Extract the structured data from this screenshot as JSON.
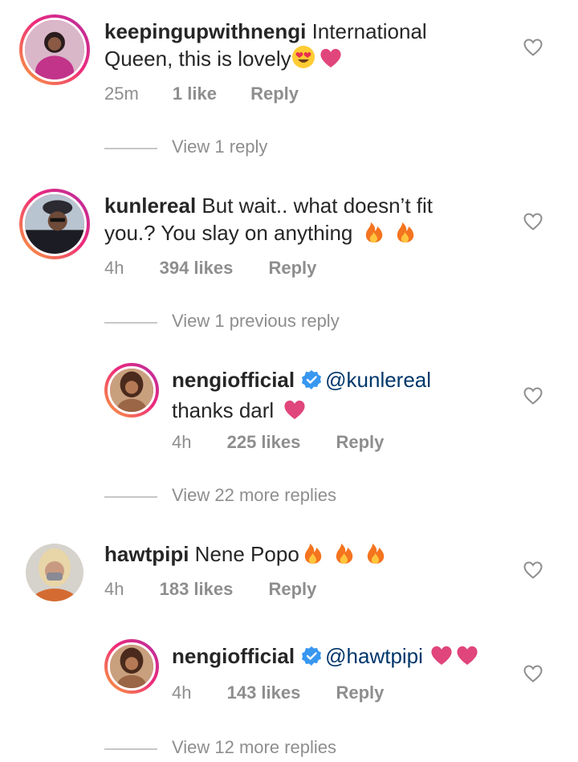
{
  "comments": [
    {
      "username": "keepingupwithnengi",
      "text_line1": "International",
      "text_line2": "Queen, this is lovely",
      "time": "25m",
      "likes": "1 like",
      "reply": "Reply",
      "view_replies": "View 1 reply"
    },
    {
      "username": "kunlereal",
      "text_line1": "But wait.. what doesn’t fit",
      "text_line2": "you.? You slay on anything",
      "time": "4h",
      "likes": "394 likes",
      "reply": "Reply",
      "view_replies": "View 1 previous reply"
    },
    {
      "username": "nengiofficial",
      "mention": "@kunlereal",
      "text_line2": "thanks darl",
      "time": "4h",
      "likes": "225 likes",
      "reply": "Reply",
      "view_replies": "View 22 more replies"
    },
    {
      "username": "hawtpipi",
      "text_line1": "Nene Popo",
      "time": "4h",
      "likes": "183 likes",
      "reply": "Reply"
    },
    {
      "username": "nengiofficial",
      "mention": "@hawtpipi",
      "time": "4h",
      "likes": "143 likes",
      "reply": "Reply",
      "view_replies": "View 12 more replies"
    }
  ],
  "colors": {
    "text": "#262626",
    "secondary": "#8e8e8e",
    "mention": "#00376b",
    "verified": "#3897f0",
    "heart_emoji": "#e0457b"
  },
  "icons": [
    "heart-outline-icon",
    "verified-badge-icon",
    "red-heart-emoji",
    "fire-emoji",
    "heart-eyes-emoji"
  ]
}
